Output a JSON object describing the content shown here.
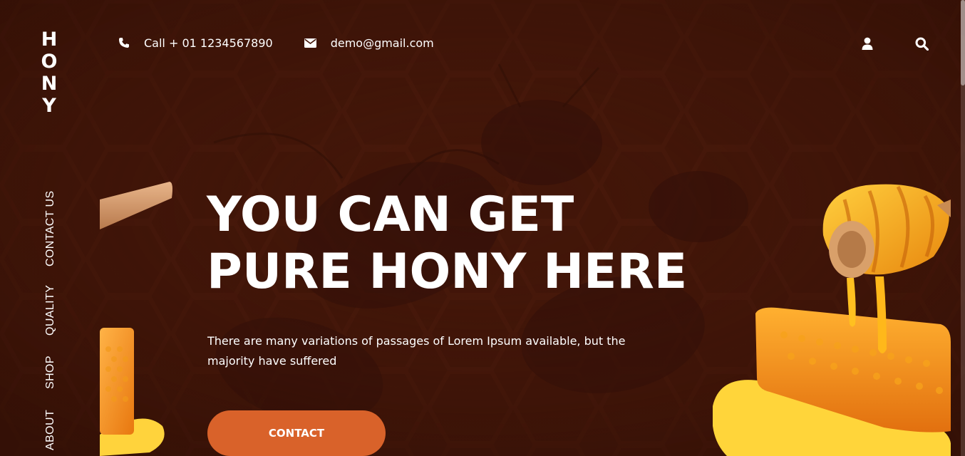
{
  "brand": {
    "letters": [
      "H",
      "O",
      "N",
      "Y"
    ]
  },
  "sidebar": {
    "items": [
      {
        "label": "CONTACT US"
      },
      {
        "label": "QUALITY"
      },
      {
        "label": "SHOP"
      },
      {
        "label": "ABOUT"
      }
    ]
  },
  "topbar": {
    "phone": {
      "icon": "phone-icon",
      "text": "Call + 01 1234567890"
    },
    "email": {
      "icon": "envelope-icon",
      "text": "demo@gmail.com"
    },
    "actions": [
      {
        "icon": "user-icon"
      },
      {
        "icon": "search-icon"
      }
    ]
  },
  "hero": {
    "title_line1": "YOU CAN GET",
    "title_line2": "PURE HONY HERE",
    "description": "There are many variations of passages of Lorem Ipsum available, but the majority have suffered",
    "cta_label": "CONTACT"
  },
  "colors": {
    "background": "#3f1509",
    "accent": "#d9622a",
    "text": "#ffffff",
    "honey": "#f7a21b"
  }
}
